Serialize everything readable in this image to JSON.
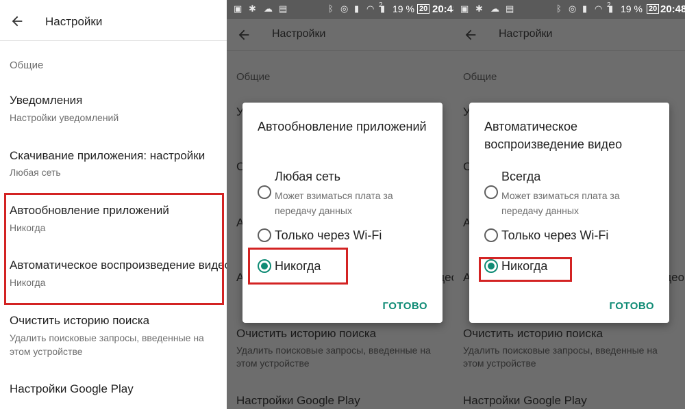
{
  "colors": {
    "accent": "#0f8b75",
    "highlight": "#d32323",
    "statusbar": "#5a5a5a",
    "scrim": "#6d6d6d"
  },
  "status_bar": {
    "battery_percent": "19 %",
    "battery_charge": "20",
    "time": "20:48",
    "sim_badge": "2",
    "icons": [
      "gallery-icon",
      "android-icon",
      "cloud-icon",
      "card-icon",
      "bluetooth-icon",
      "alarm-icon",
      "signal-icon",
      "wifi-icon",
      "sim-signal-icon",
      "battery-icon"
    ]
  },
  "header": {
    "title": "Настройки",
    "back_icon": "back-arrow-icon"
  },
  "settings": {
    "section_general": "Общие",
    "items": [
      {
        "title": "Уведомления",
        "subtitle": "Настройки уведомлений"
      },
      {
        "title": "Скачивание приложения: настройки",
        "subtitle": "Любая сеть"
      },
      {
        "title": "Автообновление приложений",
        "subtitle": "Никогда"
      },
      {
        "title": "Автоматическое воспроизведение видео",
        "subtitle": "Никогда"
      },
      {
        "title": "Очистить историю поиска",
        "subtitle_line1": "Удалить поисковые запросы, введенные на",
        "subtitle_line2": "этом устройстве"
      },
      {
        "title": "Настройки Google Play"
      }
    ]
  },
  "dialog_autoupdate": {
    "title": "Автообновление приложений",
    "options": [
      {
        "label": "Любая сеть",
        "sub": "Может взиматься плата за передачу данных",
        "checked": false
      },
      {
        "label": "Только через Wi-Fi",
        "checked": false
      },
      {
        "label": "Никогда",
        "checked": true
      }
    ],
    "done": "ГОТОВО"
  },
  "dialog_autoplay": {
    "title": "Автоматическое воспроизведение видео",
    "options": [
      {
        "label": "Всегда",
        "sub": "Может взиматься плата за передачу данных",
        "checked": false
      },
      {
        "label": "Только через Wi-Fi",
        "checked": false
      },
      {
        "label": "Никогда",
        "checked": true
      }
    ],
    "done": "ГОТОВО"
  }
}
